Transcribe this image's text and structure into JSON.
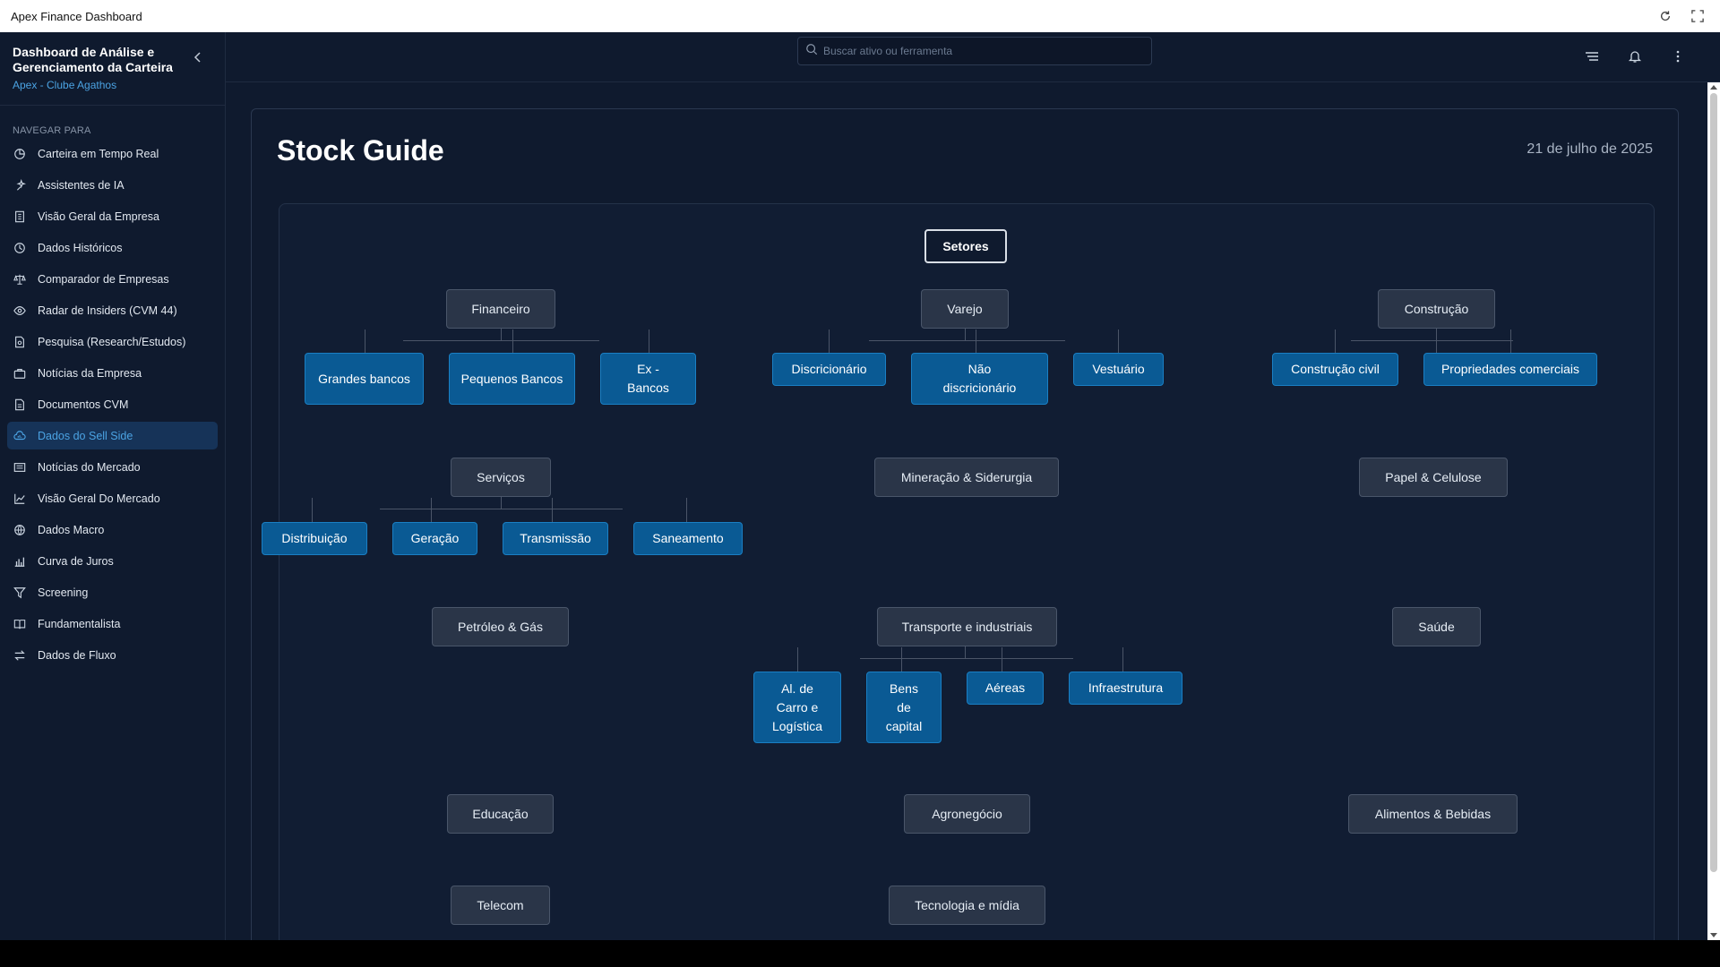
{
  "window": {
    "title": "Apex Finance Dashboard"
  },
  "sidebar": {
    "title": "Dashboard de Análise e Gerenciamento da Carteira",
    "subtitle": "Apex - Clube Agathos",
    "nav_label": "NAVEGAR PARA",
    "items": [
      {
        "label": "Carteira em Tempo Real",
        "icon": "pie-chart-icon"
      },
      {
        "label": "Assistentes de IA",
        "icon": "sparkles-icon"
      },
      {
        "label": "Visão Geral da Empresa",
        "icon": "building-icon"
      },
      {
        "label": "Dados Históricos",
        "icon": "clock-icon"
      },
      {
        "label": "Comparador de Empresas",
        "icon": "scale-icon"
      },
      {
        "label": "Radar de Insiders (CVM 44)",
        "icon": "eye-icon"
      },
      {
        "label": "Pesquisa (Research/Estudos)",
        "icon": "document-search-icon"
      },
      {
        "label": "Notícias da Empresa",
        "icon": "briefcase-icon"
      },
      {
        "label": "Documentos CVM",
        "icon": "document-icon"
      },
      {
        "label": "Dados do Sell Side",
        "icon": "cloud-chart-icon",
        "active": true
      },
      {
        "label": "Notícias do Mercado",
        "icon": "newspaper-icon"
      },
      {
        "label": "Visão Geral Do Mercado",
        "icon": "chart-line-icon"
      },
      {
        "label": "Dados Macro",
        "icon": "globe-icon"
      },
      {
        "label": "Curva de Juros",
        "icon": "bar-chart-icon"
      },
      {
        "label": "Screening",
        "icon": "filter-icon"
      },
      {
        "label": "Fundamentalista",
        "icon": "book-icon"
      },
      {
        "label": "Dados de Fluxo",
        "icon": "arrows-icon"
      }
    ]
  },
  "topbar": {
    "search_placeholder": "Buscar ativo ou ferramenta"
  },
  "page": {
    "title": "Stock Guide",
    "date": "21 de julho de 2025"
  },
  "tree": {
    "root": "Setores",
    "financeiro": {
      "label": "Financeiro",
      "children": [
        "Grandes bancos",
        "Pequenos Bancos",
        "Ex - Bancos"
      ]
    },
    "varejo": {
      "label": "Varejo",
      "children": [
        "Discricionário",
        "Não discricionário",
        "Vestuário"
      ]
    },
    "construcao": {
      "label": "Construção",
      "children": [
        "Construção civil",
        "Propriedades comerciais"
      ]
    },
    "servicos": {
      "label": "Serviços",
      "children": [
        "Distribuição",
        "Geração",
        "Transmissão",
        "Saneamento"
      ]
    },
    "mineracao": {
      "label": "Mineração & Siderurgia"
    },
    "papel": {
      "label": "Papel & Celulose"
    },
    "petroleo": {
      "label": "Petróleo & Gás"
    },
    "transporte": {
      "label": "Transporte e industriais",
      "children": [
        "Al. de Carro e Logística",
        "Bens de capital",
        "Aéreas",
        "Infraestrutura"
      ]
    },
    "saude": {
      "label": "Saúde"
    },
    "educacao": {
      "label": "Educação"
    },
    "agronegocio": {
      "label": "Agronegócio"
    },
    "alimentos": {
      "label": "Alimentos & Bebidas"
    },
    "telecom": {
      "label": "Telecom"
    },
    "tecnologia": {
      "label": "Tecnologia e mídia"
    }
  }
}
